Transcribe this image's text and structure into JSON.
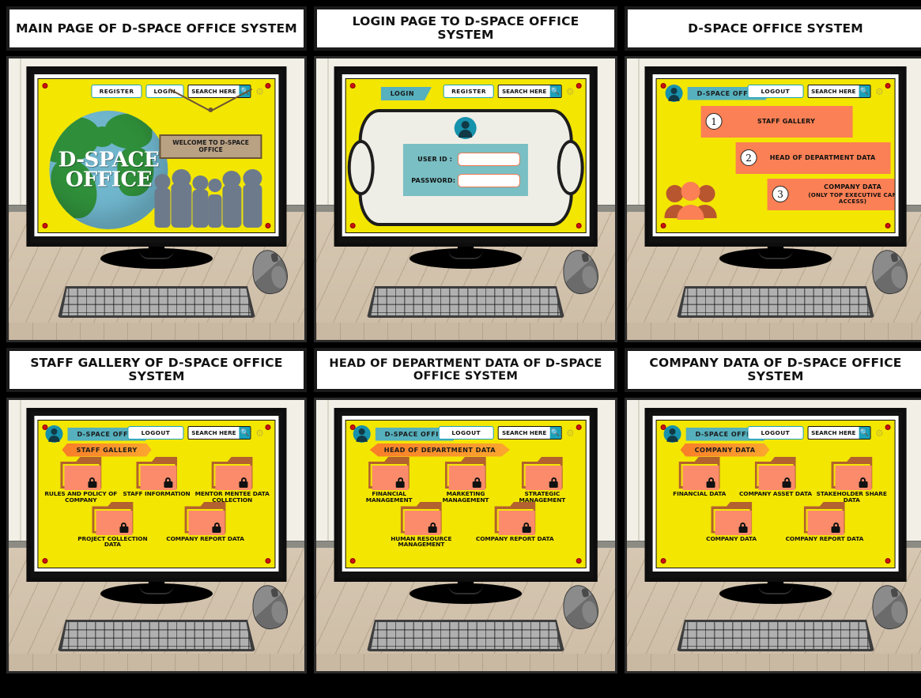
{
  "colors": {
    "screen_yellow": "#f3e600",
    "teal": "#56b0bd",
    "orange": "#fb8055",
    "folder_front": "#fb8b6b",
    "folder_back": "#b2612f",
    "accent_cyan": "#1aa0b8",
    "pin_red": "#cc1111"
  },
  "common": {
    "search_placeholder": "SEARCH HERE",
    "search_icon": "search-icon",
    "gear_icon": "gear-icon",
    "avatar_icon": "user-avatar-icon",
    "lock_icon": "padlock-icon",
    "folder_icon": "folder-icon",
    "logout_label": "LOGOUT",
    "register_label": "REGISTER",
    "login_label": "LOGIN",
    "brand_tag": "D-SPACE OFFICE"
  },
  "panels": [
    {
      "id": "main-page",
      "title": "MAIN PAGE OF D-SPACE OFFICE SYSTEM",
      "buttons": [
        "REGISTER",
        "LOGIN"
      ],
      "search_placeholder": "SEARCH HERE",
      "globe_text_line1": "D-SPACE",
      "globe_text_line2": "OFFICE",
      "sign_text": "WELCOME TO D-SPACE OFFICE"
    },
    {
      "id": "login-page",
      "title": "LOGIN PAGE TO D-SPACE OFFICE SYSTEM",
      "tab_label": "LOGIN",
      "buttons": [
        "REGISTER"
      ],
      "search_placeholder": "SEARCH HERE",
      "fields": [
        {
          "label": "USER ID :",
          "value": ""
        },
        {
          "label": "PASSWORD:",
          "value": ""
        }
      ]
    },
    {
      "id": "dashboard",
      "title": "D-SPACE OFFICE SYSTEM",
      "brand_tag": "D-SPACE OFFICE",
      "logout_label": "LOGOUT",
      "search_placeholder": "SEARCH HERE",
      "menu": [
        {
          "num": "1",
          "label": "STAFF GALLERY",
          "sub": ""
        },
        {
          "num": "2",
          "label": "HEAD OF DEPARTMENT DATA",
          "sub": ""
        },
        {
          "num": "3",
          "label": "COMPANY DATA",
          "sub": "(ONLY TOP EXECUTIVE CAN ACCESS)"
        }
      ]
    },
    {
      "id": "staff-gallery",
      "title": "STAFF GALLERY OF D-SPACE OFFICE SYSTEM",
      "brand_tag": "D-SPACE OFFICE",
      "section_tag": "STAFF GALLERY",
      "logout_label": "LOGOUT",
      "search_placeholder": "SEARCH HERE",
      "folders_row1": [
        "RULES AND POLICY OF COMPANY",
        "STAFF INFORMATION",
        "MENTOR MENTEE DATA COLLECTION"
      ],
      "folders_row2": [
        "PROJECT COLLECTION DATA",
        "COMPANY REPORT DATA"
      ]
    },
    {
      "id": "head-of-department",
      "title": "HEAD OF DEPARTMENT DATA OF D-SPACE OFFICE SYSTEM",
      "brand_tag": "D-SPACE OFFICE",
      "section_tag": "HEAD OF DEPARTMENT DATA",
      "logout_label": "LOGOUT",
      "search_placeholder": "SEARCH HERE",
      "folders_row1": [
        "FINANCIAL MANAGEMENT",
        "MARKETING MANAGEMENT",
        "STRATEGIC MANAGEMENT"
      ],
      "folders_row2": [
        "HUMAN RESOURCE MANAGEMENT",
        "COMPANY REPORT DATA"
      ]
    },
    {
      "id": "company-data",
      "title": "COMPANY DATA OF D-SPACE OFFICE SYSTEM",
      "brand_tag": "D-SPACE OFFICE",
      "section_tag": "COMPANY DATA",
      "logout_label": "LOGOUT",
      "search_placeholder": "SEARCH HERE",
      "folders_row1": [
        "FINANCIAL DATA",
        "COMPANY ASSET DATA",
        "STAKEHOLDER SHARE DATA"
      ],
      "folders_row2": [
        "COMPANY DATA",
        "COMPANY REPORT DATA"
      ]
    }
  ]
}
